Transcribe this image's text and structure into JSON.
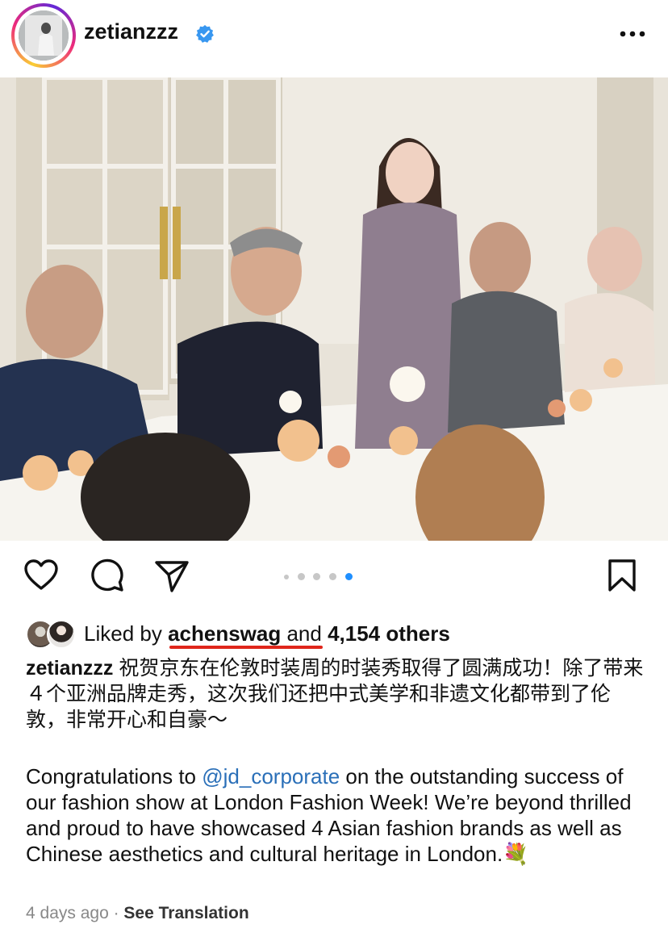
{
  "post": {
    "username": "zetianzzz",
    "verified": true,
    "avatar_icon": "profile-photo",
    "more_icon": "more-horizontal-icon"
  },
  "media": {
    "description_hidden": true,
    "carousel_total": 5,
    "carousel_active_index": 4
  },
  "actions": {
    "like_icon": "heart-icon",
    "comment_icon": "comment-icon",
    "share_icon": "share-icon",
    "save_icon": "bookmark-icon"
  },
  "likes": {
    "prefix": "Liked by ",
    "user": "achenswag",
    "middle": " and ",
    "others": "4,154 others",
    "underline_color": "#e0261b"
  },
  "caption": {
    "user": "zetianzzz",
    "chinese": "祝贺京东在伦敦时装周的时装秀取得了圆满成功！除了带来４个亚洲品牌走秀，这次我们还把中式美学和非遗文化都带到了伦敦，非常开心和自豪～",
    "en_before": "Congratulations to ",
    "mention": "@jd_corporate",
    "en_after": " on the outstanding success of our fashion show at London Fashion Week! We’re beyond thrilled and proud to have showcased 4 Asian fashion brands as well as Chinese aesthetics and cultural heritage in London.",
    "emoji": "💐"
  },
  "footer": {
    "time": "4 days ago",
    "separator": " · ",
    "see_translation": "See Translation"
  },
  "colors": {
    "link": "#2a6fb8",
    "text": "#111111",
    "muted": "#888888",
    "dot_active": "#1f8fff",
    "dot_inactive": "#c7c7c7"
  }
}
